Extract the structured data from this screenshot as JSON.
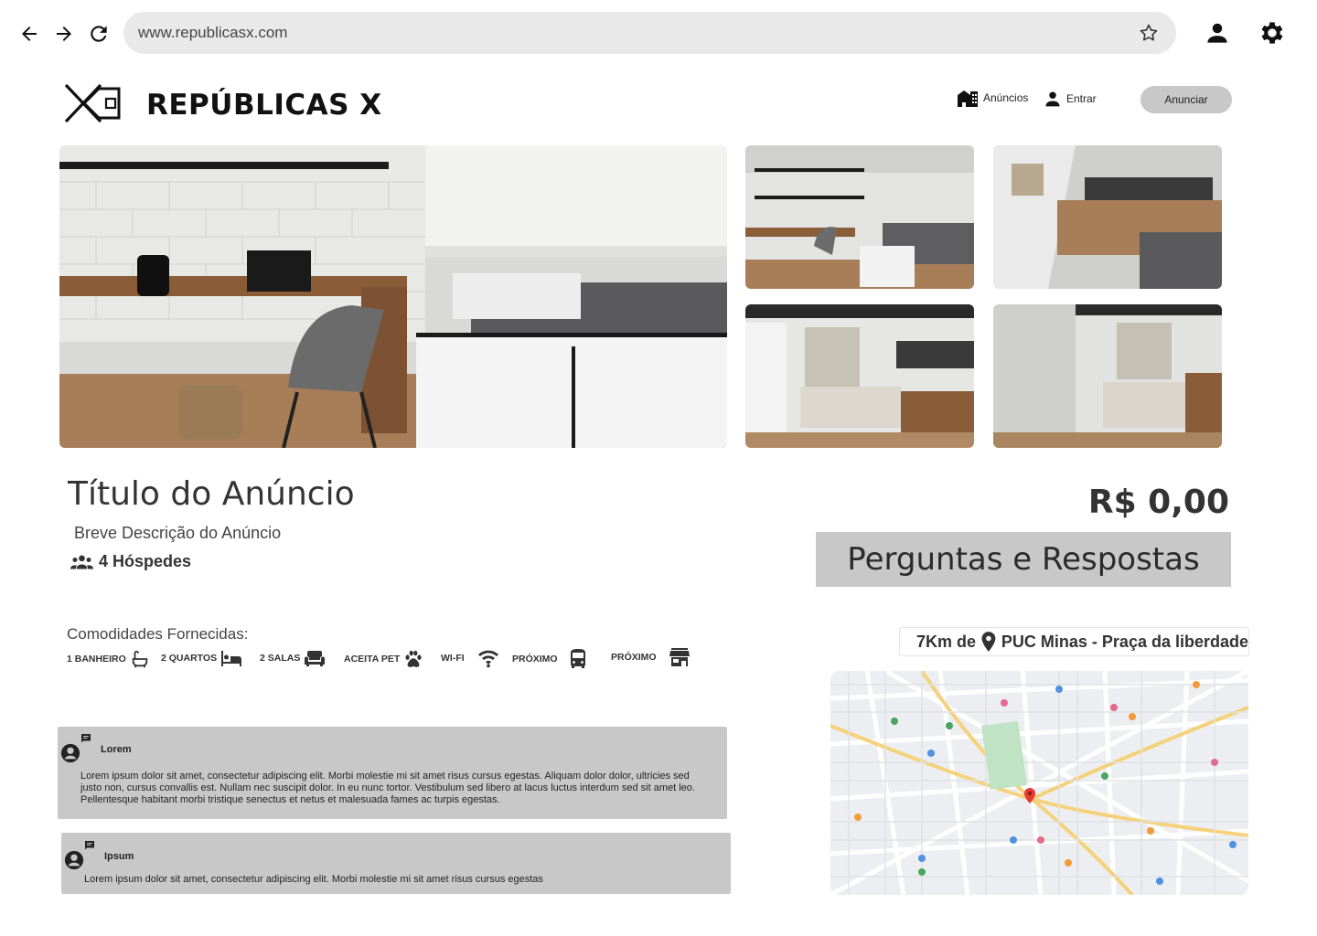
{
  "browser": {
    "url": "www.republicasx.com"
  },
  "header": {
    "brand": "REPÚBLICAS X",
    "nav_anuncios": "Anúncios",
    "nav_entrar": "Entrar",
    "anunciar_label": "Anunciar"
  },
  "listing": {
    "title": "Título do Anúncio",
    "description": "Breve Descrição do Anúncio",
    "guests": "4 Hóspedes",
    "price": "R$ 0,00",
    "qa_label": "Perguntas e Respostas"
  },
  "amenities": {
    "heading": "Comodidades Fornecidas:",
    "items": [
      {
        "label": "1 BANHEIRO",
        "icon": "bathtub-icon"
      },
      {
        "label": "2 QUARTOS",
        "icon": "bed-icon"
      },
      {
        "label": "2 SALAS",
        "icon": "sofa-icon"
      },
      {
        "label": "ACEITA PET",
        "icon": "paw-icon"
      },
      {
        "label": "WI-FI",
        "icon": "wifi-icon"
      },
      {
        "label": "PRÓXIMO",
        "icon": "bus-icon"
      },
      {
        "label": "PRÓXIMO",
        "icon": "store-icon"
      }
    ]
  },
  "location": {
    "distance": "7Km de",
    "place": "PUC Minas - Praça da liberdade"
  },
  "comments": [
    {
      "author": "Lorem",
      "text": "Lorem ipsum dolor sit amet, consectetur adipiscing elit. Morbi molestie mi sit amet risus cursus egestas. Aliquam dolor dolor, ultricies sed justo non, cursus convallis est. Nullam nec suscipit dolor. In eu nunc tortor. Vestibulum sed libero at lacus luctus interdum sed sit amet leo. Pellentesque habitant morbi tristique senectus et netus et malesuada fames ac turpis egestas."
    },
    {
      "author": "Ipsum",
      "text": "Lorem ipsum dolor sit amet, consectetur adipiscing elit. Morbi molestie mi sit amet risus cursus egestas"
    }
  ],
  "colors": {
    "gray_panel": "#c8c8c8",
    "text": "#2f2f2f",
    "url_bar": "#e9e9e9"
  }
}
